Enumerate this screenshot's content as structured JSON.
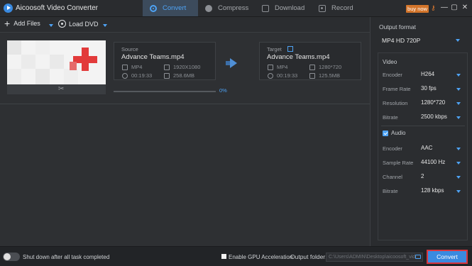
{
  "app": {
    "title": "Aicoosoft Video Converter"
  },
  "tabs": [
    {
      "label": "Convert",
      "icon": "convert-icon",
      "active": true
    },
    {
      "label": "Compress",
      "icon": "compress-icon",
      "active": false
    },
    {
      "label": "Download",
      "icon": "download-icon",
      "active": false
    },
    {
      "label": "Record",
      "icon": "record-icon",
      "active": false
    }
  ],
  "header": {
    "buy_now": "buy now",
    "minimize": "—",
    "restore": "▢",
    "close": "✕"
  },
  "toolbar": {
    "add_files": "Add Files",
    "load_dvd": "Load DVD"
  },
  "file": {
    "source": {
      "header": "Source",
      "name": "Advance Teams.mp4",
      "format": "MP4",
      "resolution": "1920X1080",
      "duration": "00:19:33",
      "size": "258.6MB"
    },
    "target": {
      "header": "Target",
      "name": "Advance Teams.mp4",
      "format": "MP4",
      "resolution": "1280*720",
      "duration": "00:19:33",
      "size": "125.5MB"
    },
    "progress_text": "0%",
    "progress_value": 0
  },
  "output": {
    "title": "Output format",
    "format": "MP4 HD 720P",
    "video": {
      "title": "Video",
      "encoder_label": "Encoder",
      "encoder": "H264",
      "frame_rate_label": "Frame Rate",
      "frame_rate": "30 fps",
      "resolution_label": "Resolution",
      "resolution": "1280*720",
      "bitrate_label": "Bitrate",
      "bitrate": "2500 kbps"
    },
    "audio": {
      "title": "Audio",
      "enabled": true,
      "encoder_label": "Encoder",
      "encoder": "AAC",
      "sample_rate_label": "Sample Rate",
      "sample_rate": "44100 Hz",
      "channel_label": "Channel",
      "channel": "2",
      "bitrate_label": "Bitrate",
      "bitrate": "128 kbps"
    }
  },
  "bottom": {
    "shutdown_label": "Shut down after all task completed",
    "gpu_label": "Enable GPU Acceleration",
    "output_folder_label": "Output folder:",
    "output_folder_value": "C:\\Users\\ADMIN\\Desktop\\aicoosoft_vid",
    "convert_button": "Convert"
  },
  "colors": {
    "accent": "#4ea3f5",
    "convert_button": "#3a8ae0",
    "highlight_border": "#d9363e",
    "buy_now": "#d3752b"
  }
}
